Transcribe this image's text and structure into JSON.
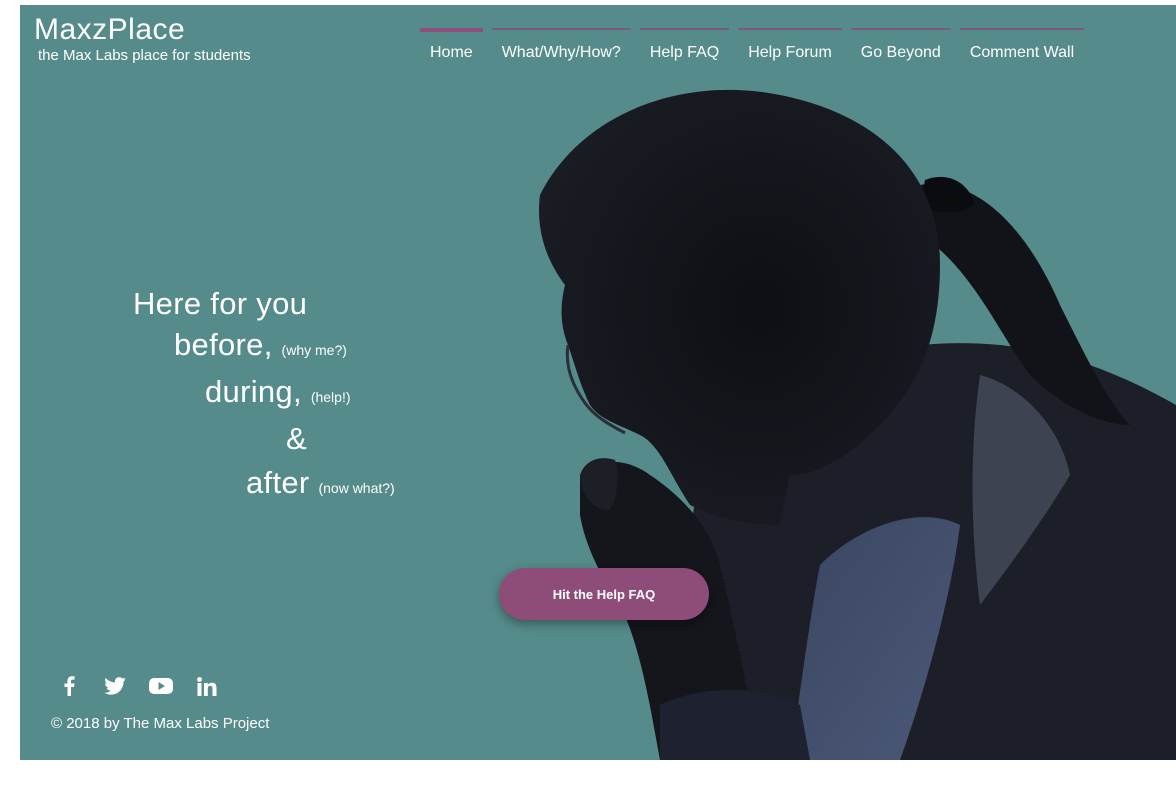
{
  "brand": {
    "title": "MaxzPlace",
    "subtitle": "the Max Labs place for students"
  },
  "nav": {
    "items": [
      {
        "label": "Home",
        "active": true
      },
      {
        "label": "What/Why/How?",
        "active": false
      },
      {
        "label": "Help FAQ",
        "active": false
      },
      {
        "label": "Help Forum",
        "active": false
      },
      {
        "label": "Go Beyond",
        "active": false
      },
      {
        "label": "Comment Wall",
        "active": false
      }
    ]
  },
  "hero": {
    "line1": "Here for you",
    "line2_main": "before,",
    "line2_note": "(why me?)",
    "line3_main": "during,",
    "line3_note": "(help!)",
    "line4_main": "&",
    "line5_main": "after",
    "line5_note": "(now what?)"
  },
  "cta": {
    "label": "Hit the Help FAQ"
  },
  "social": {
    "icons": [
      "facebook-icon",
      "twitter-icon",
      "youtube-icon",
      "linkedin-icon"
    ]
  },
  "footer": {
    "copyright": "© 2018 by The Max Labs Project"
  },
  "colors": {
    "background": "#558b8b",
    "accent": "#8e4d78",
    "text": "#ffffff"
  }
}
